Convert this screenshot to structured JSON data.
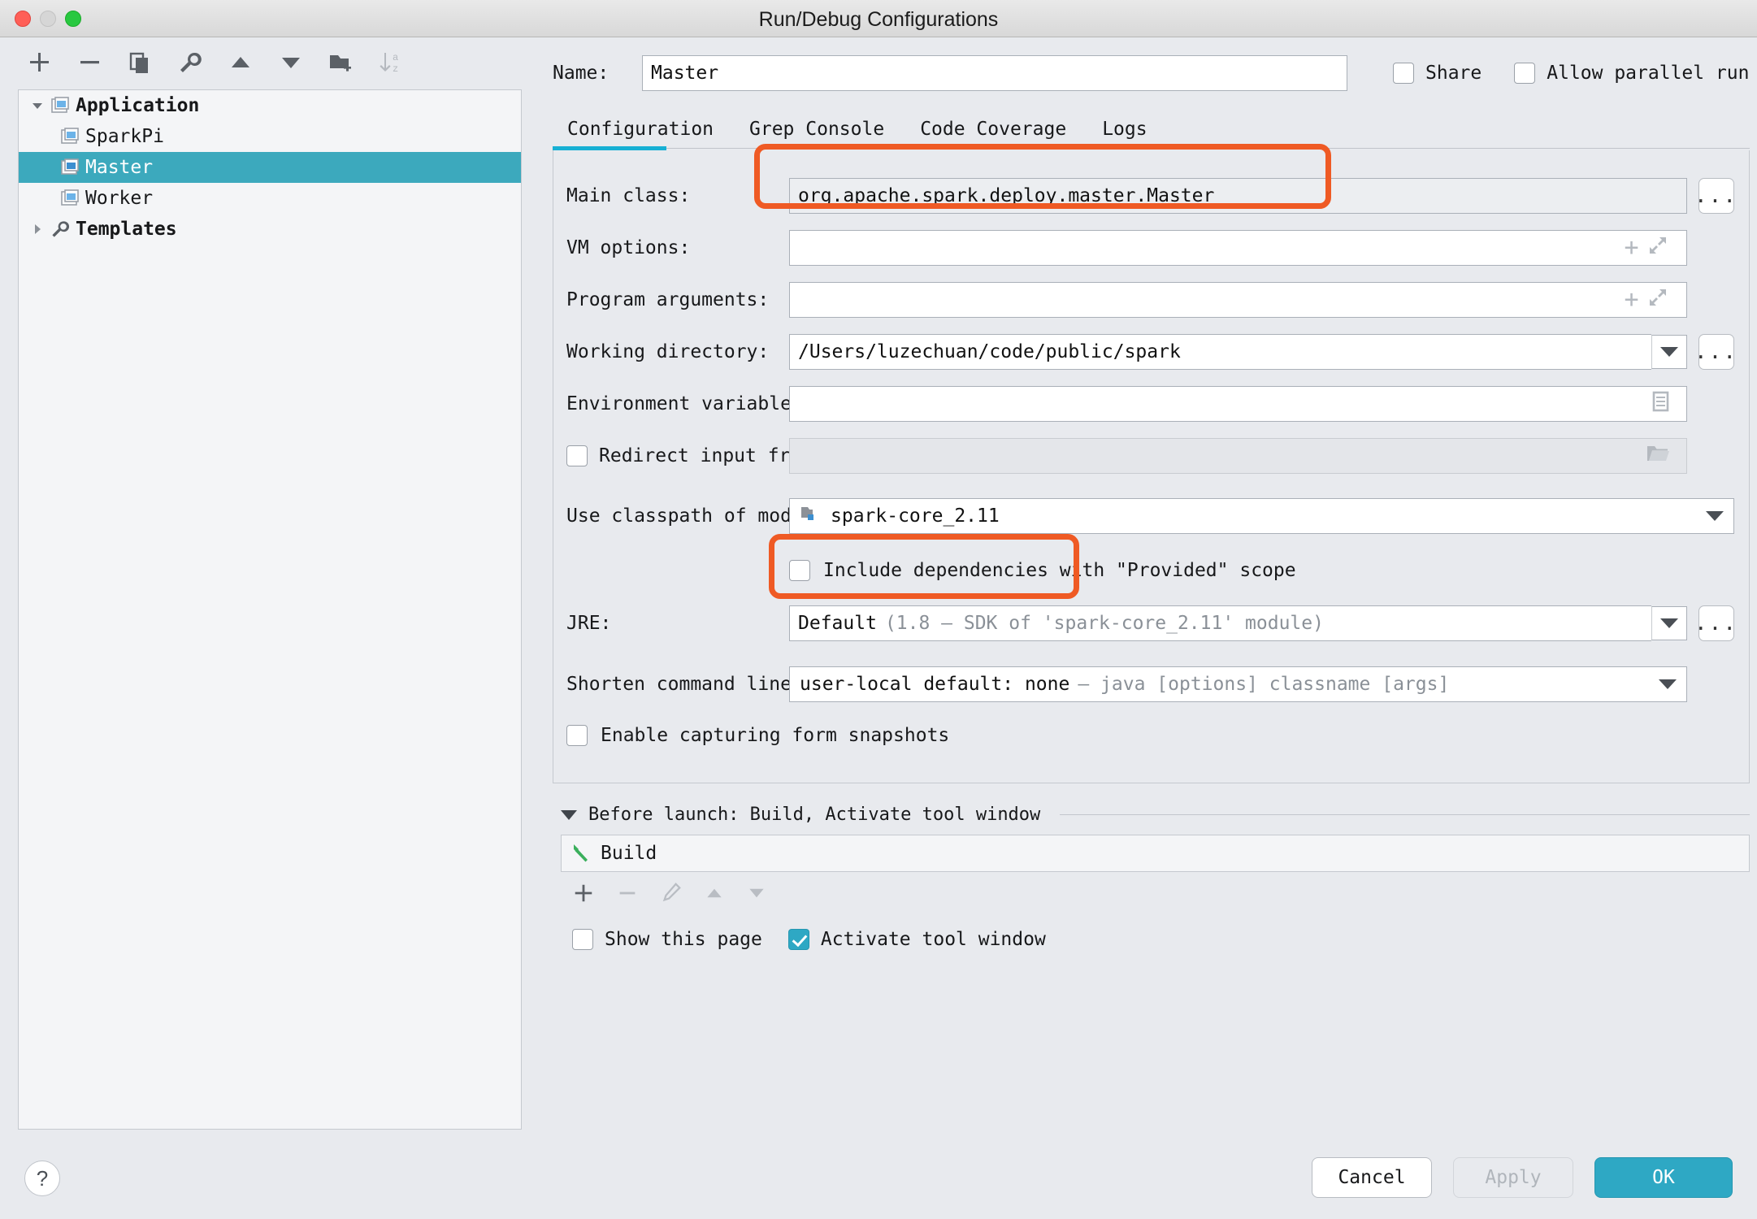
{
  "window": {
    "title": "Run/Debug Configurations",
    "traffic_lights": [
      "close",
      "minimize",
      "zoom"
    ]
  },
  "toolbar": {
    "buttons": [
      {
        "name": "add-configuration",
        "icon": "plus-icon",
        "label": "+"
      },
      {
        "name": "remove-configuration",
        "icon": "minus-icon",
        "label": "−"
      },
      {
        "name": "copy-configuration",
        "icon": "copy-icon",
        "label": "copy"
      },
      {
        "name": "edit-templates",
        "icon": "wrench-icon",
        "label": "wrench"
      },
      {
        "name": "move-up",
        "icon": "arrow-up-icon",
        "label": "up"
      },
      {
        "name": "move-down",
        "icon": "arrow-down-icon",
        "label": "down"
      },
      {
        "name": "move-into-folder",
        "icon": "folder-add-icon",
        "label": "folder"
      },
      {
        "name": "sort-configurations",
        "icon": "sort-az-icon",
        "label": "sort"
      }
    ]
  },
  "tree": {
    "items": [
      {
        "label": "Application",
        "level": 0,
        "expanded": true,
        "icon": "application-icon",
        "selected": false,
        "bold": true
      },
      {
        "label": "SparkPi",
        "level": 1,
        "icon": "run-config-icon",
        "selected": false,
        "bold": false
      },
      {
        "label": "Master",
        "level": 1,
        "icon": "run-config-icon",
        "selected": true,
        "bold": false
      },
      {
        "label": "Worker",
        "level": 1,
        "icon": "run-config-icon",
        "selected": false,
        "bold": false
      },
      {
        "label": "Templates",
        "level": 0,
        "expanded": false,
        "icon": "wrench-icon",
        "selected": false,
        "bold": true
      }
    ]
  },
  "name_row": {
    "label": "Name:",
    "value": "Master",
    "share": {
      "label": "Share",
      "checked": false
    },
    "allow_parallel": {
      "label": "Allow parallel run",
      "checked": false
    }
  },
  "tabs": [
    {
      "label": "Configuration",
      "active": true
    },
    {
      "label": "Grep Console",
      "active": false
    },
    {
      "label": "Code Coverage",
      "active": false
    },
    {
      "label": "Logs",
      "active": false
    }
  ],
  "configuration": {
    "main_class": {
      "label": "Main class:",
      "value": "org.apache.spark.deploy.master.Master",
      "browse_label": "...",
      "highlighted": true
    },
    "vm_options": {
      "label": "VM options:",
      "value": "",
      "placeholder": "",
      "macro_icon": "plus-icon",
      "expand_icon": "expand-icon"
    },
    "program_arguments": {
      "label": "Program arguments:",
      "value": "",
      "placeholder": "",
      "macro_icon": "plus-icon",
      "expand_icon": "expand-icon"
    },
    "working_directory": {
      "label": "Working directory:",
      "value": "/Users/luzechuan/code/public/spark",
      "browse_label": "..."
    },
    "environment_variables": {
      "label": "Environment variables:",
      "value": "",
      "editor_icon": "list-edit-icon"
    },
    "redirect_input": {
      "label": "Redirect input from:",
      "checked": false,
      "value": "",
      "folder_icon": "folder-icon"
    },
    "use_classpath_of_module": {
      "label": "Use classpath of module:",
      "value": "spark-core_2.11",
      "module_icon": "module-icon",
      "highlighted": true
    },
    "include_provided": {
      "label": "Include dependencies with \"Provided\" scope",
      "checked": false
    },
    "jre": {
      "label": "JRE:",
      "value_main": "Default",
      "value_detail": "(1.8 – SDK of 'spark-core_2.11' module)",
      "browse_label": "..."
    },
    "shorten_command_line": {
      "label": "Shorten command line:",
      "value_main": "user-local default: none",
      "value_detail": "– java [options] classname [args]"
    },
    "enable_capturing": {
      "label": "Enable capturing form snapshots",
      "checked": false
    }
  },
  "before_launch": {
    "header": "Before launch: Build, Activate tool window",
    "items": [
      {
        "label": "Build",
        "icon": "build-hammer-icon"
      }
    ],
    "toolbar": [
      {
        "name": "add-task",
        "icon": "plus-icon",
        "enabled": true
      },
      {
        "name": "remove-task",
        "icon": "minus-icon",
        "enabled": false
      },
      {
        "name": "edit-task",
        "icon": "pencil-icon",
        "enabled": false
      },
      {
        "name": "move-task-up",
        "icon": "arrow-up-icon",
        "enabled": false
      },
      {
        "name": "move-task-down",
        "icon": "arrow-down-icon",
        "enabled": false
      }
    ],
    "show_this_page": {
      "label": "Show this page",
      "checked": false
    },
    "activate_tool_window": {
      "label": "Activate tool window",
      "checked": true
    }
  },
  "footer": {
    "help_label": "?",
    "cancel_label": "Cancel",
    "apply_label": "Apply",
    "apply_enabled": false,
    "ok_label": "OK"
  },
  "colors": {
    "accent": "#2ea8c4",
    "selection": "#3ca9bd",
    "highlight_ring": "#ef5a24",
    "tab_indicator": "#17b0d4",
    "build_icon": "#3aaf5c"
  }
}
